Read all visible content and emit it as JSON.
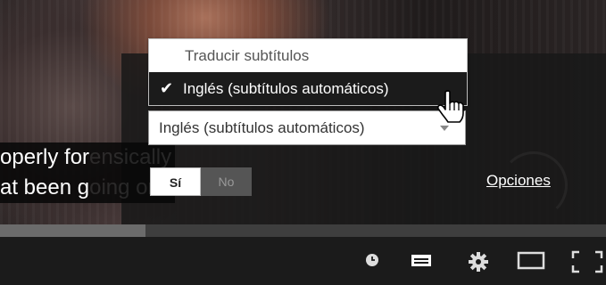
{
  "caption_text": {
    "line1_visible": "operly for",
    "line1_faded": "ensically",
    "line2_visible": "at been g",
    "line2_faded": "oing on"
  },
  "translate_menu": {
    "header": "Traducir subtítulos",
    "selected_item": "Inglés (subtítulos automáticos)",
    "check_glyph": "✔"
  },
  "language_select": {
    "value": "Inglés (subtítulos automáticos)"
  },
  "toggle": {
    "on_label": "Sí",
    "off_label": "No"
  },
  "options_link": "Opciones",
  "progress": {
    "loaded_fraction": 0.24
  },
  "controls": {
    "icons": [
      "clock-icon",
      "captions-icon",
      "gear-icon",
      "theater-mode-icon",
      "fullscreen-icon"
    ]
  }
}
